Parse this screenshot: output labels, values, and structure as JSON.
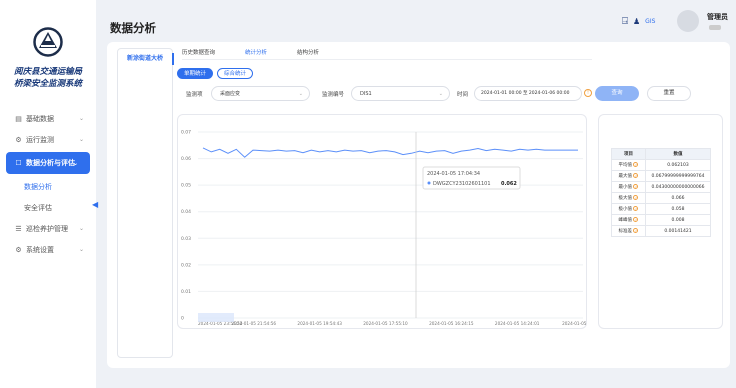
{
  "sidebar": {
    "org_line1": "阅庆县交通运输局",
    "org_line2": "桥梁安全监测系统",
    "items": [
      {
        "label": "基础数据",
        "icon": "grid-icon",
        "chevron": "⌄"
      },
      {
        "label": "运行监测",
        "icon": "gear-icon",
        "chevron": "⌄"
      },
      {
        "label": "数据分析与评估",
        "icon": "chart-icon",
        "chevron": "⌄"
      },
      {
        "label": "数据分析"
      },
      {
        "label": "安全评估"
      },
      {
        "label": "巡检养护管理",
        "icon": "list-icon",
        "chevron": "⌄"
      },
      {
        "label": "系统设置",
        "icon": "settings-icon",
        "chevron": "⌄"
      }
    ]
  },
  "header": {
    "title": "数据分析",
    "gis": "GIS",
    "user": "管理员"
  },
  "left_panel": {
    "bridge": "新涂街道大桥"
  },
  "tabs": [
    "历史数据查询",
    "统计分析",
    "结构分析"
  ],
  "subtabs": [
    "单期统计",
    "综合统计"
  ],
  "filters": {
    "item_label": "监测项",
    "item_value": "采面应变",
    "code_label": "监测编号",
    "code_value": "DIS1",
    "time_label": "时间",
    "time_value": "2024-01-01 00:00  至  2024-01-06 00:00",
    "query": "查询",
    "reset": "重置"
  },
  "tooltip": {
    "time": "2024-01-05 17:04:34",
    "series": "DWGZCY23102601101",
    "value": "0.062"
  },
  "chart_data": {
    "type": "line",
    "x": [
      "2024-01-05 23:55:52",
      "2024-01-05 21:54:56",
      "2024-01-05 19:54:43",
      "2024-01-05 17:55:10",
      "2024-01-05 16:24:15",
      "2024-01-05 14:24:01",
      "2024-01-05 12:24:0"
    ],
    "y_ticks": [
      "0.07",
      "0.06",
      "0.05",
      "0.04",
      "0.03",
      "0.02",
      "0.01",
      "0"
    ],
    "ylim": [
      0,
      0.07
    ],
    "series": [
      {
        "values": [
          0.064,
          0.0625,
          0.0635,
          0.062,
          0.0635,
          0.0605,
          0.0632,
          0.063,
          0.0628,
          0.0632,
          0.0628,
          0.063,
          0.0622,
          0.0632,
          0.0625,
          0.063,
          0.0625,
          0.0632,
          0.0628,
          0.063,
          0.0622,
          0.0628,
          0.063,
          0.0625,
          0.0615,
          0.062,
          0.0628,
          0.0622,
          0.0628,
          0.063,
          0.062,
          0.0628,
          0.0632,
          0.0638,
          0.063,
          0.0635,
          0.0632,
          0.0628,
          0.0635,
          0.0632,
          0.0635,
          0.0632,
          0.0632,
          0.0632,
          0.0632,
          0.0632
        ],
        "color": "#5b8ff9"
      }
    ]
  },
  "stats": {
    "headers": [
      "项目",
      "数值"
    ],
    "rows": [
      {
        "k": "平均值",
        "v": "0.062103"
      },
      {
        "k": "最大值",
        "v": "0.06799999999999764"
      },
      {
        "k": "最小值",
        "v": "0.04300000000000066"
      },
      {
        "k": "极大值",
        "v": "0.066"
      },
      {
        "k": "极小值",
        "v": "0.058"
      },
      {
        "k": "峰峰值",
        "v": "0.008"
      },
      {
        "k": "标准差",
        "v": "0.00141421"
      }
    ]
  }
}
